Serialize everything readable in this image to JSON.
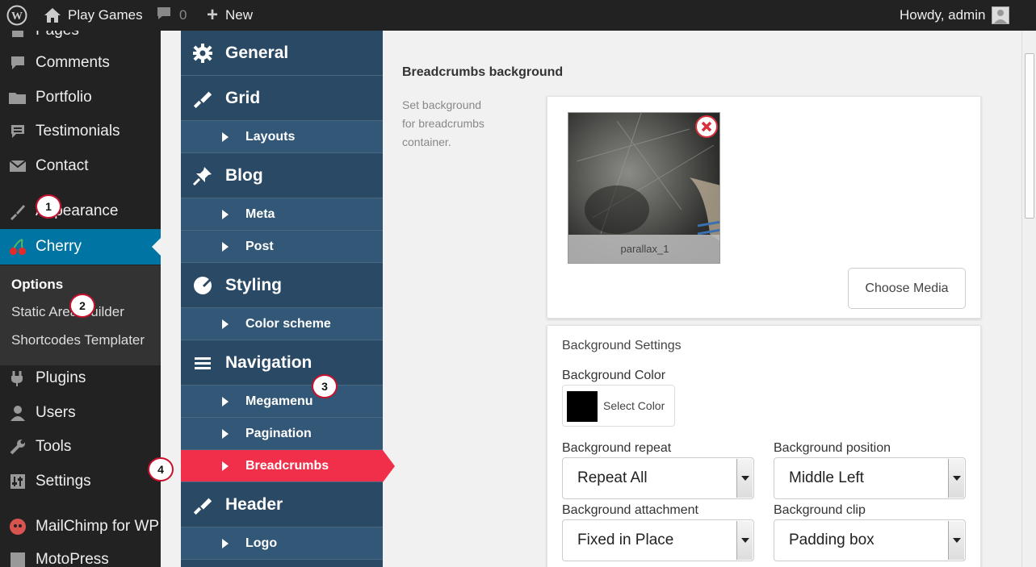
{
  "admin_bar": {
    "site_name": "Play Games",
    "comments_count": "0",
    "new_label": "New",
    "greeting": "Howdy, admin"
  },
  "sidebar": {
    "items": [
      {
        "label": "Pages",
        "icon": "pages-icon"
      },
      {
        "label": "Comments",
        "icon": "comments-icon"
      },
      {
        "label": "Portfolio",
        "icon": "portfolio-icon"
      },
      {
        "label": "Testimonials",
        "icon": "testimonials-icon"
      },
      {
        "label": "Contact",
        "icon": "contact-icon"
      },
      {
        "label": "Appearance",
        "icon": "appearance-icon"
      },
      {
        "label": "Cherry",
        "icon": "cherry-icon"
      },
      {
        "label": "Plugins",
        "icon": "plugins-icon"
      },
      {
        "label": "Users",
        "icon": "users-icon"
      },
      {
        "label": "Tools",
        "icon": "tools-icon"
      },
      {
        "label": "Settings",
        "icon": "settings-icon"
      },
      {
        "label": "MailChimp for WP",
        "icon": "mailchimp-icon"
      },
      {
        "label": "MotoPress",
        "icon": "motopress-icon"
      }
    ],
    "submenu": [
      {
        "label": "Options"
      },
      {
        "label": "Static Area Builder"
      },
      {
        "label": "Shortcodes Templater"
      }
    ]
  },
  "options_nav": {
    "sections": [
      {
        "label": "General",
        "icon": "gear-icon"
      },
      {
        "label": "Grid",
        "icon": "brush-icon"
      },
      {
        "label": "Blog",
        "icon": "pin-icon"
      },
      {
        "label": "Styling",
        "icon": "palette-icon"
      },
      {
        "label": "Navigation",
        "icon": "menu-icon"
      },
      {
        "label": "Header",
        "icon": "brush-icon"
      }
    ],
    "subsections": [
      {
        "label": "Layouts"
      },
      {
        "label": "Meta"
      },
      {
        "label": "Post"
      },
      {
        "label": "Color scheme"
      },
      {
        "label": "Megamenu"
      },
      {
        "label": "Pagination"
      },
      {
        "label": "Breadcrumbs"
      },
      {
        "label": "Logo"
      }
    ]
  },
  "main": {
    "title": "Breadcrumbs background",
    "description": "Set background for breadcrumbs container.",
    "media_caption": "parallax_1",
    "choose_media": "Choose Media",
    "bg_settings_title": "Background Settings",
    "bg_color_label": "Background Color",
    "select_color": "Select Color",
    "selected_color": "#000000",
    "repeat_label": "Background repeat",
    "repeat_value": "Repeat All",
    "position_label": "Background position",
    "position_value": "Middle Left",
    "attachment_label": "Background attachment",
    "attachment_value": "Fixed in Place",
    "clip_label": "Background clip",
    "clip_value": "Padding box"
  },
  "annotations": [
    "1",
    "2",
    "3",
    "4"
  ],
  "colors": {
    "accent_red": "#f0304a",
    "wp_blue": "#0074a2",
    "panel_navy": "#2a4964"
  }
}
